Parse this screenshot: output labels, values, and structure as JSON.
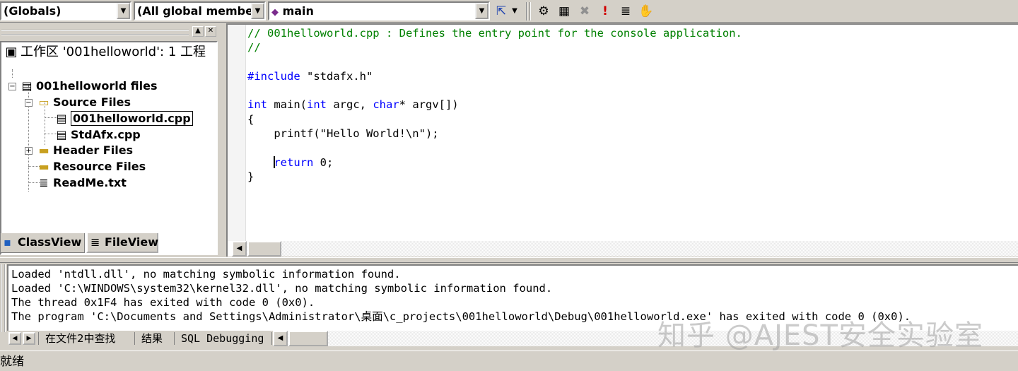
{
  "toolbar": {
    "scope_combo": "(Globals)",
    "members_combo": "(All global members",
    "function_combo": "main",
    "icons": [
      "wizard-bar-action-icon",
      "dropdown-arrow-icon",
      "compile-icon",
      "build-icon",
      "stop-build-icon",
      "execute-icon",
      "go-icon",
      "breakpoint-icon"
    ],
    "glyphs": [
      "⇱",
      "▼",
      "⚙",
      "▦",
      "✖",
      "!",
      "≣",
      "✋"
    ]
  },
  "workspace": {
    "root": "工作区 '001helloworld': 1 工程",
    "project": "001helloworld files",
    "source_folder": "Source Files",
    "source_files": [
      "001helloworld.cpp",
      "StdAfx.cpp"
    ],
    "header_folder": "Header Files",
    "resource_folder": "Resource Files",
    "readme": "ReadMe.txt",
    "tabs": [
      "ClassView",
      "FileView"
    ]
  },
  "editor": {
    "lines": [
      "// 001helloworld.cpp : Defines the entry point for the console application.",
      "//",
      "",
      "#include \"stdafx.h\"",
      "",
      "int main(int argc, char* argv[])",
      "{",
      "    printf(\"Hello World!\\n\");",
      "",
      "    return 0;",
      "}"
    ],
    "parts": {
      "l1": "// 001helloworld.cpp : Defines the entry point for the console application.",
      "l2": "//",
      "l4_kw": "#include",
      "l4_rest": " \"stdafx.h\"",
      "l6_kw1": "int",
      "l6_a": " main(",
      "l6_kw2": "int",
      "l6_b": " argc, ",
      "l6_kw3": "char",
      "l6_c": "* argv[])",
      "l7": "{",
      "l8": "    printf(\"Hello World!\\n\");",
      "l10_indent": "    ",
      "l10_kw": "return",
      "l10_rest": " 0;",
      "l11": "}"
    }
  },
  "output": {
    "lines": [
      "Loaded 'ntdll.dll', no matching symbolic information found.",
      "Loaded 'C:\\WINDOWS\\system32\\kernel32.dll', no matching symbolic information found.",
      "The thread 0x1F4 has exited with code 0 (0x0).",
      "The program 'C:\\Documents and Settings\\Administrator\\桌面\\c_projects\\001helloworld\\Debug\\001helloworld.exe' has exited with code 0 (0x0)."
    ],
    "tabs": [
      "在文件2中查找",
      "结果",
      "SQL Debugging"
    ]
  },
  "watermark": "知乎 @AJEST安全实验室",
  "status": "就绪"
}
